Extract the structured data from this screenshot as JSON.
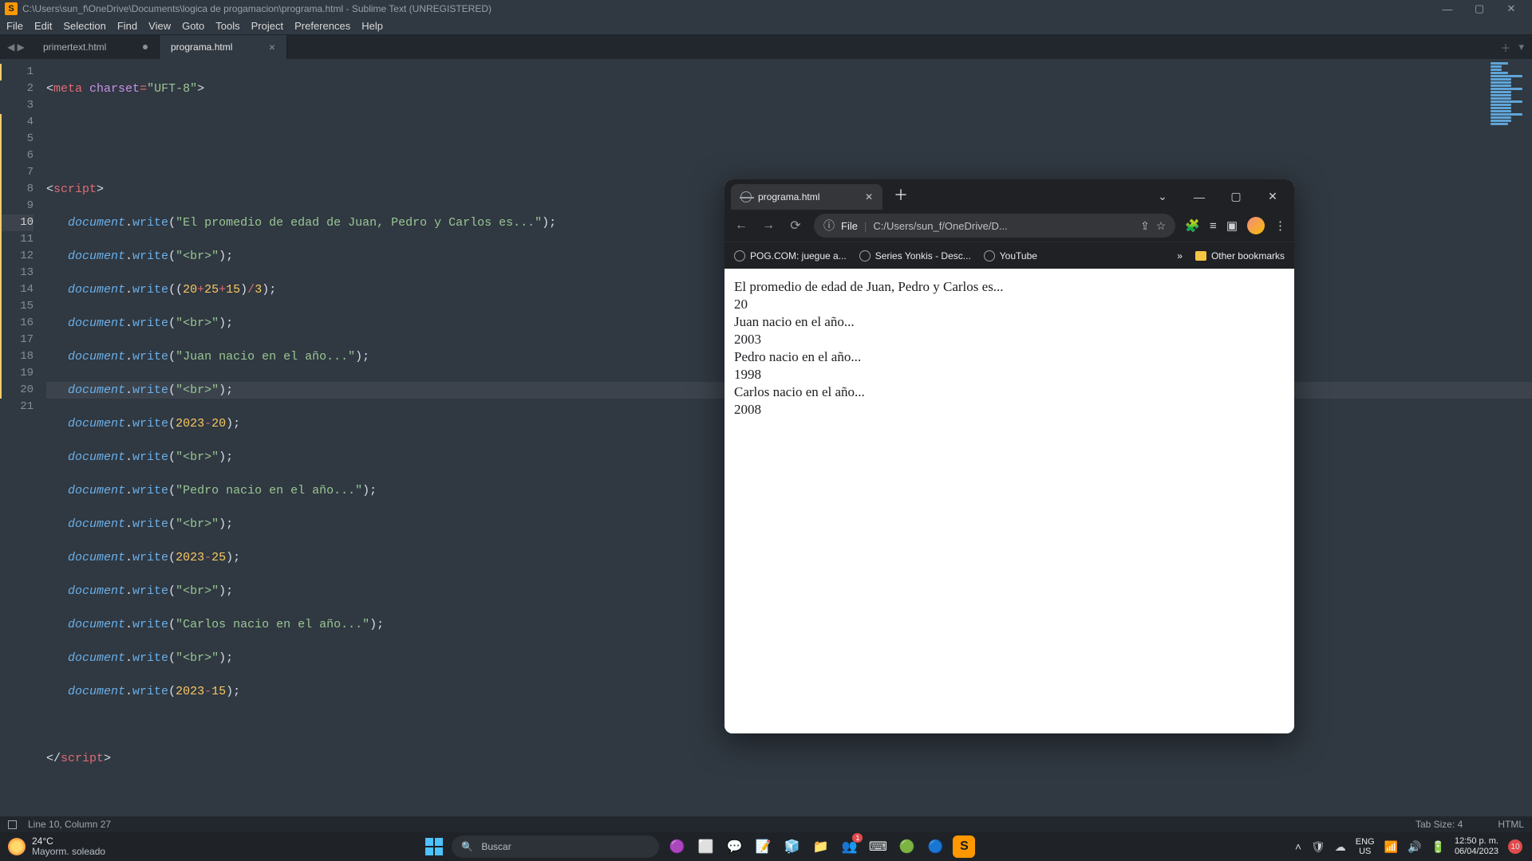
{
  "titlebar": {
    "path": "C:\\Users\\sun_f\\OneDrive\\Documents\\logica de progamacion\\programa.html - Sublime Text (UNREGISTERED)"
  },
  "menu": [
    "File",
    "Edit",
    "Selection",
    "Find",
    "View",
    "Goto",
    "Tools",
    "Project",
    "Preferences",
    "Help"
  ],
  "tabs": {
    "t1": "primertext.html",
    "t2": "programa.html"
  },
  "code": {
    "l1": {
      "tag": "meta",
      "attr": "charset",
      "op": "=",
      "str": "\"UFT-8\""
    },
    "l4": {
      "tag": "script"
    },
    "write": "write",
    "doc": "document",
    "s5": "\"El promedio de edad de Juan, Pedro y Carlos es...\"",
    "sbr": "\"<br>\"",
    "n7a": "20",
    "n7b": "25",
    "n7c": "15",
    "n7d": "3",
    "s9": "\"Juan nacio en el año...\"",
    "n11a": "2023",
    "n11b": "20",
    "s13": "\"Pedro nacio en el año...\"",
    "n15a": "2023",
    "n15b": "25",
    "s17": "\"Carlos nacio en el año...\"",
    "n19a": "2023",
    "n19b": "15",
    "end": "script"
  },
  "lines": [
    "1",
    "2",
    "3",
    "4",
    "5",
    "6",
    "7",
    "8",
    "9",
    "10",
    "11",
    "12",
    "13",
    "14",
    "15",
    "16",
    "17",
    "18",
    "19",
    "20",
    "21"
  ],
  "status": {
    "pos": "Line 10, Column 27",
    "tabsize": "Tab Size: 4",
    "syntax": "HTML"
  },
  "chrome": {
    "tab_title": "programa.html",
    "file_label": "File",
    "url": "C:/Users/sun_f/OneDrive/D...",
    "bookmarks": {
      "b1": "POG.COM: juegue a...",
      "b2": "Series Yonkis - Desc...",
      "b3": "YouTube",
      "other": "Other bookmarks",
      "more": "»"
    },
    "page": [
      "El promedio de edad de Juan, Pedro y Carlos es...",
      "20",
      "Juan nacio en el año...",
      "2003",
      "Pedro nacio en el año...",
      "1998",
      "Carlos nacio en el año...",
      "2008"
    ]
  },
  "taskbar": {
    "temp": "24°C",
    "weather": "Mayorm. soleado",
    "search": "Buscar",
    "lang1": "ENG",
    "lang2": "US",
    "time": "12:50 p. m.",
    "date": "06/04/2023",
    "notif": "10",
    "chat_badge": "1"
  }
}
